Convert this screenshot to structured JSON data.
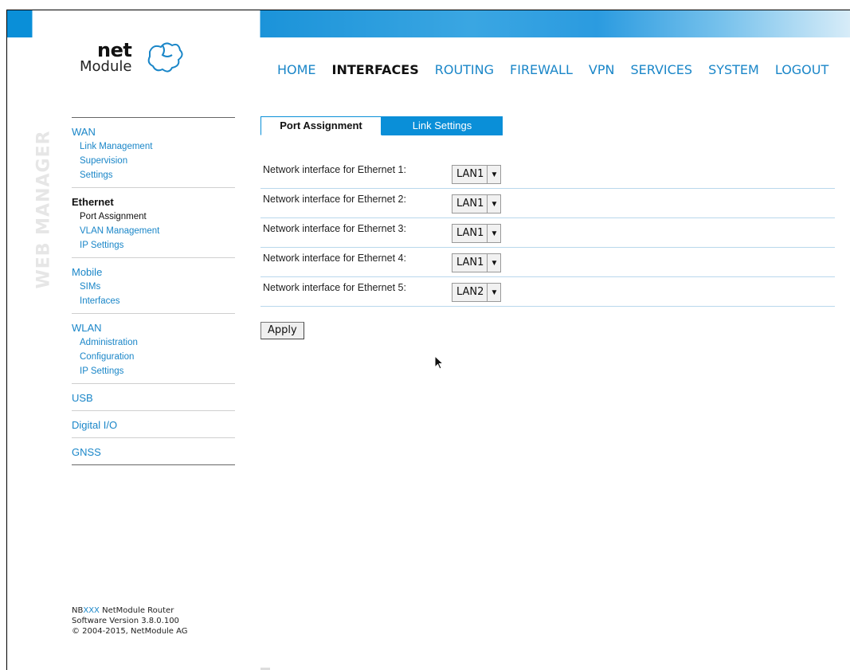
{
  "brand": {
    "logo_net": "net",
    "logo_module": "Module",
    "side_title": "WEB MANAGER"
  },
  "topnav": [
    {
      "label": "HOME"
    },
    {
      "label": "INTERFACES",
      "active": true
    },
    {
      "label": "ROUTING"
    },
    {
      "label": "FIREWALL"
    },
    {
      "label": "VPN"
    },
    {
      "label": "SERVICES"
    },
    {
      "label": "SYSTEM"
    },
    {
      "label": "LOGOUT"
    }
  ],
  "sidebar": {
    "wan": {
      "title": "WAN",
      "items": [
        "Link Management",
        "Supervision",
        "Settings"
      ]
    },
    "ethernet": {
      "title": "Ethernet",
      "items": [
        "Port Assignment",
        "VLAN Management",
        "IP Settings"
      ]
    },
    "mobile": {
      "title": "Mobile",
      "items": [
        "SIMs",
        "Interfaces"
      ]
    },
    "wlan": {
      "title": "WLAN",
      "items": [
        "Administration",
        "Configuration",
        "IP Settings"
      ]
    },
    "usb": {
      "title": "USB"
    },
    "digital_io": {
      "title": "Digital I/O"
    },
    "gnss": {
      "title": "GNSS"
    }
  },
  "tabs": {
    "port_assignment": "Port Assignment",
    "link_settings": "Link Settings"
  },
  "rows": [
    {
      "label": "Network interface for Ethernet 1:",
      "value": "LAN1"
    },
    {
      "label": "Network interface for Ethernet 2:",
      "value": "LAN1"
    },
    {
      "label": "Network interface for Ethernet 3:",
      "value": "LAN1"
    },
    {
      "label": "Network interface for Ethernet 4:",
      "value": "LAN1"
    },
    {
      "label": "Network interface for Ethernet 5:",
      "value": "LAN2"
    }
  ],
  "apply_label": "Apply",
  "footer": {
    "line1_prefix": "NB",
    "line1_xxx": "XXX",
    "line1_suffix": " NetModule Router",
    "line2": "Software Version 3.8.0.100",
    "line3": "© 2004-2015, NetModule AG"
  },
  "colors": {
    "accent": "#0a8fd8",
    "link": "#1a86c8"
  }
}
